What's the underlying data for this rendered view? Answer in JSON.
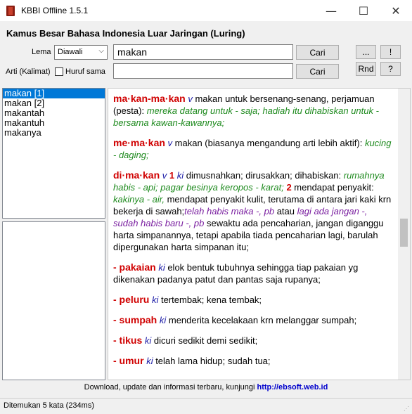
{
  "window": {
    "title": "KBBI Offline 1.5.1",
    "minimize": "—",
    "maximize": "☐",
    "close": "✕"
  },
  "heading": "Kamus Besar Bahasa Indonesia Luar Jaringan (Luring)",
  "search": {
    "lema_label": "Lema",
    "lema_mode": "Diawali",
    "lema_value": "makan",
    "cari_label": "Cari",
    "arti_label": "Arti (Kalimat)",
    "huruf_sama_label": "Huruf sama",
    "huruf_sama_checked": false,
    "arti_value": "",
    "cari2_label": "Cari"
  },
  "tools": {
    "more": "...",
    "bang": "!",
    "rnd": "Rnd",
    "help": "?"
  },
  "results": [
    "makan [1]",
    "makan [2]",
    "makantah",
    "makantuh",
    "makanya"
  ],
  "entries": {
    "e1": {
      "hw": "ma·kan-ma·kan",
      "pos": "v",
      "def": " makan untuk bersenang-senang, perjamuan (pesta): ",
      "ex": "mereka datang untuk - saja; hadiah itu dihabiskan untuk - bersama kawan-kawannya;"
    },
    "e2": {
      "hw": "me·ma·kan",
      "pos": "v",
      "def": " makan (biasanya mengandung arti lebih aktif): ",
      "ex": "kucing - daging;"
    },
    "e3": {
      "hw": "di·ma·kan",
      "pos": "v",
      "n1": "1",
      "ki": "ki",
      "def1": " dimusnahkan; dirusakkan; dihabiskan: ",
      "ex1": "rumahnya habis - api; pagar besinya keropos - karat;",
      "n2": "2",
      "def2": " mendapat penyakit: ",
      "ex2": "kakinya - air,",
      "def3": " mendapat penyakit kulit, terutama di antara jari kaki krn bekerja di sawah;",
      "ex3": "telah habis maka -, pb",
      "def4": " atau ",
      "ex4": "lagi ada jangan -, sudah habis baru -, pb",
      "def5": " sewaktu ada pencaharian, jangan diganggu harta simpanannya, tetapi apabila tiada pencaharian lagi, barulah dipergunakan harta simpanan itu;"
    },
    "e4": {
      "hw": "- pakaian",
      "ki": "ki",
      "def": " elok bentuk tubuhnya sehingga tiap pakaian yg dikenakan padanya patut dan pantas saja rupanya;"
    },
    "e5": {
      "hw": "- peluru",
      "ki": "ki",
      "def": " tertembak; kena tembak;"
    },
    "e6": {
      "hw": "- sumpah",
      "ki": "ki",
      "def": " menderita kecelakaan krn melanggar sumpah;"
    },
    "e7": {
      "hw": "- tikus",
      "ki": "ki",
      "def": " dicuri sedikit demi sedikit;"
    },
    "e8": {
      "hw": "- umur",
      "ki": "ki",
      "def": " telah lama hidup; sudah tua;"
    }
  },
  "footer": {
    "text": "Download, update dan informasi terbaru, kunjungi ",
    "link": "http://ebsoft.web.id"
  },
  "status": "Ditemukan 5 kata (234ms)"
}
